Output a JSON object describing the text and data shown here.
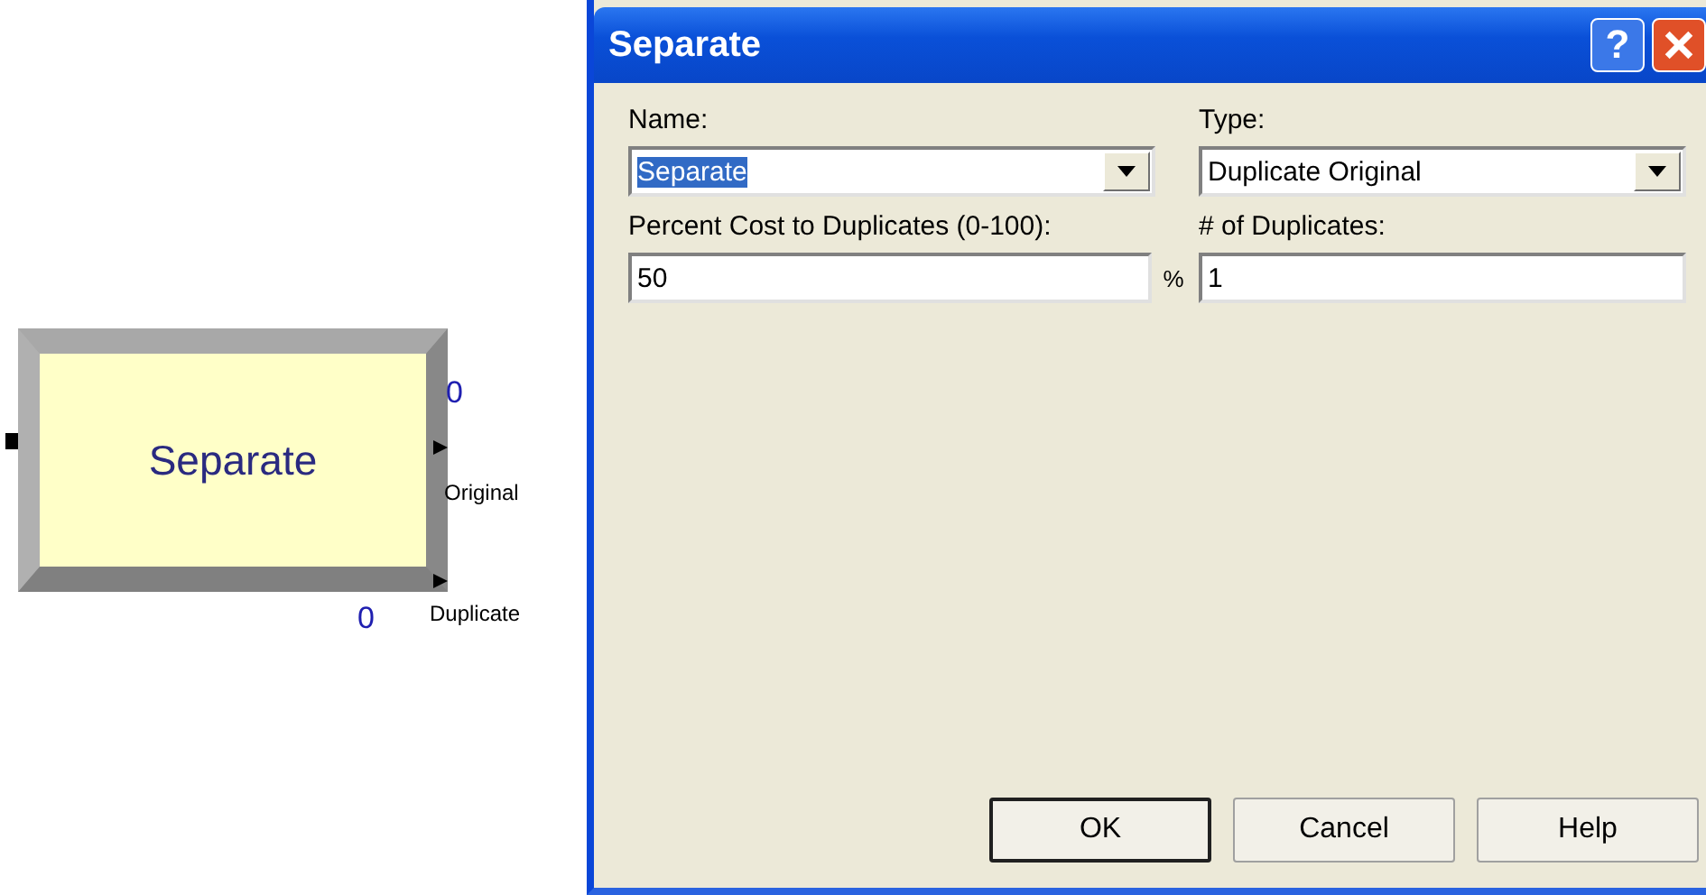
{
  "module": {
    "name": "Separate",
    "exits": [
      {
        "label": "Original",
        "count": "0"
      },
      {
        "label": "Duplicate",
        "count": "0"
      }
    ]
  },
  "dialog": {
    "title": "Separate",
    "help_glyph": "?",
    "fields": [
      {
        "label": "Name:",
        "value": "Separate",
        "kind": "combo",
        "text_selected": true
      },
      {
        "label": "Type:",
        "value": "Duplicate Original",
        "kind": "combo",
        "text_selected": false
      },
      {
        "label": "Percent Cost to Duplicates (0-100):",
        "value": "50",
        "kind": "text",
        "unit": "%",
        "text_selected": false
      },
      {
        "label": "# of Duplicates:",
        "value": "1",
        "kind": "text",
        "text_selected": false
      }
    ],
    "buttons": [
      {
        "label": "OK",
        "default": true
      },
      {
        "label": "Cancel",
        "default": false
      },
      {
        "label": "Help",
        "default": false
      }
    ]
  }
}
